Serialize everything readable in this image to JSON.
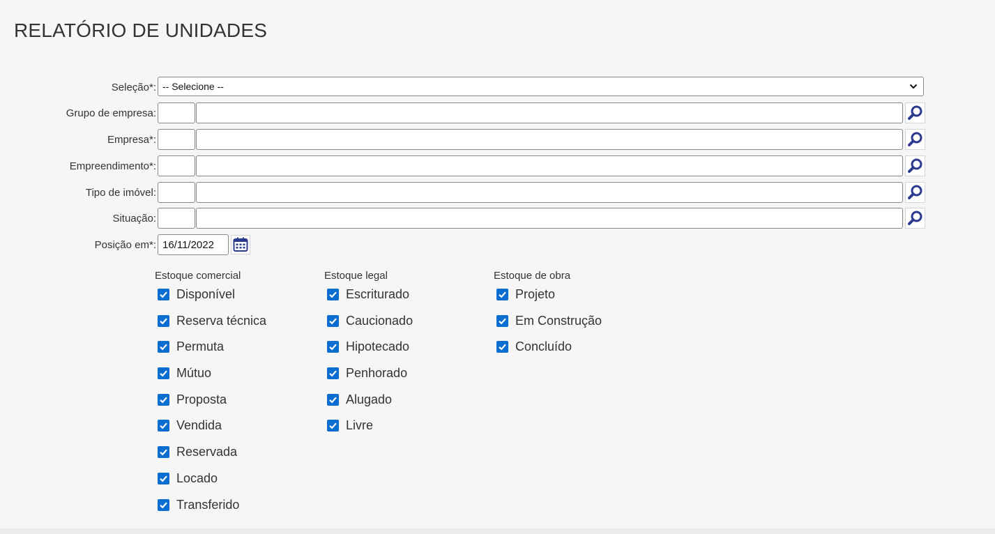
{
  "page_title": "RELATÓRIO DE UNIDADES",
  "fields": {
    "selecao": {
      "label": "Seleção*:",
      "value": "-- Selecione --"
    },
    "grupo_empresa": {
      "label": "Grupo de empresa:"
    },
    "empresa": {
      "label": "Empresa*:"
    },
    "empreendimento": {
      "label": "Empreendimento*:"
    },
    "tipo_imovel": {
      "label": "Tipo de imóvel:"
    },
    "situacao": {
      "label": "Situação:"
    },
    "posicao_em": {
      "label": "Posição em*:",
      "value": "16/11/2022"
    }
  },
  "groups": {
    "estoque_comercial": {
      "title": "Estoque comercial",
      "items": [
        "Disponível",
        "Reserva técnica",
        "Permuta",
        "Mútuo",
        "Proposta",
        "Vendida",
        "Reservada",
        "Locado",
        "Transferido"
      ]
    },
    "estoque_legal": {
      "title": "Estoque legal",
      "items": [
        "Escriturado",
        "Caucionado",
        "Hipotecado",
        "Penhorado",
        "Alugado",
        "Livre"
      ]
    },
    "estoque_obra": {
      "title": "Estoque de obra",
      "items": [
        "Projeto",
        "Em Construção",
        "Concluído"
      ]
    }
  },
  "colors": {
    "checkbox": "#0a6ed1",
    "search_icon": "#2b3a8f",
    "background": "#f6f6f6"
  },
  "icons": {
    "search": "magnifier-icon",
    "calendar": "calendar-icon",
    "select": "chevron-down-icon",
    "checkbox": "check-icon"
  }
}
